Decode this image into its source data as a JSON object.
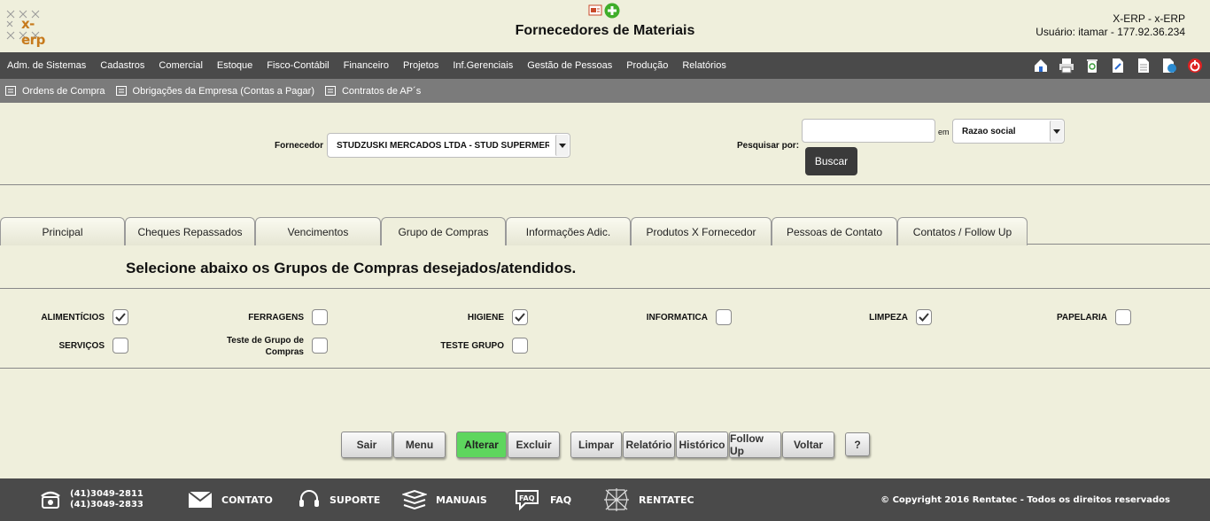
{
  "header": {
    "logo_text": "x-erp",
    "title": "Fornecedores de Materiais",
    "system_name": "X-ERP - x-ERP",
    "user_line": "Usuário: itamar - 177.92.36.234"
  },
  "menu": [
    "Adm. de Sistemas",
    "Cadastros",
    "Comercial",
    "Estoque",
    "Fisco-Contábil",
    "Financeiro",
    "Projetos",
    "Inf.Gerenciais",
    "Gestão de Pessoas",
    "Produção",
    "Relatórios"
  ],
  "submenu": [
    "Ordens de Compra",
    "Obrigações da Empresa (Contas a Pagar)",
    "Contratos de AP´s"
  ],
  "form": {
    "supplier_label": "Fornecedor",
    "supplier_value": "STUDZUSKI MERCADOS LTDA - STUD SUPERMERCADOS",
    "search_label": "Pesquisar por:",
    "search_value": "",
    "in_label": "em",
    "search_field": "Razao social",
    "search_button": "Buscar"
  },
  "tabs": [
    "Principal",
    "Cheques Repassados",
    "Vencimentos",
    "Grupo de Compras",
    "Informações Adic.",
    "Produtos X Fornecedor",
    "Pessoas de Contato",
    "Contatos / Follow Up"
  ],
  "active_tab": "Grupo de Compras",
  "section_title": "Selecione abaixo os Grupos de Compras desejados/atendidos.",
  "groups": [
    {
      "label": "ALIMENTÍCIOS",
      "checked": true
    },
    {
      "label": "FERRAGENS",
      "checked": false
    },
    {
      "label": "HIGIENE",
      "checked": true
    },
    {
      "label": "INFORMATICA",
      "checked": false
    },
    {
      "label": "LIMPEZA",
      "checked": true
    },
    {
      "label": "PAPELARIA",
      "checked": false
    },
    {
      "label": "SERVIÇOS",
      "checked": false
    },
    {
      "label": "Teste de Grupo de Compras",
      "checked": false
    },
    {
      "label": "TESTE GRUPO",
      "checked": false
    }
  ],
  "buttons": [
    "Sair",
    "Menu",
    "Alterar",
    "Excluir",
    "Limpar",
    "Relatório",
    "Histórico",
    "Follow Up",
    "Voltar",
    "?"
  ],
  "footer": {
    "phone1": "(41)3049-2811",
    "phone2": "(41)3049-2833",
    "contato": "CONTATO",
    "suporte": "SUPORTE",
    "manuais": "MANUAIS",
    "faq": "FAQ",
    "faq_icon_text": "FAQ",
    "rentatec": "RENTATEC",
    "copyright": "© Copyright 2016 Rentatec - Todos os direitos reservados"
  },
  "colors": {
    "background": "#efefdc",
    "menubar": "#4a4a4a",
    "submenu": "#7b7b7b",
    "accent_green": "#5ed65e",
    "logo_orange": "#c77a1c"
  }
}
